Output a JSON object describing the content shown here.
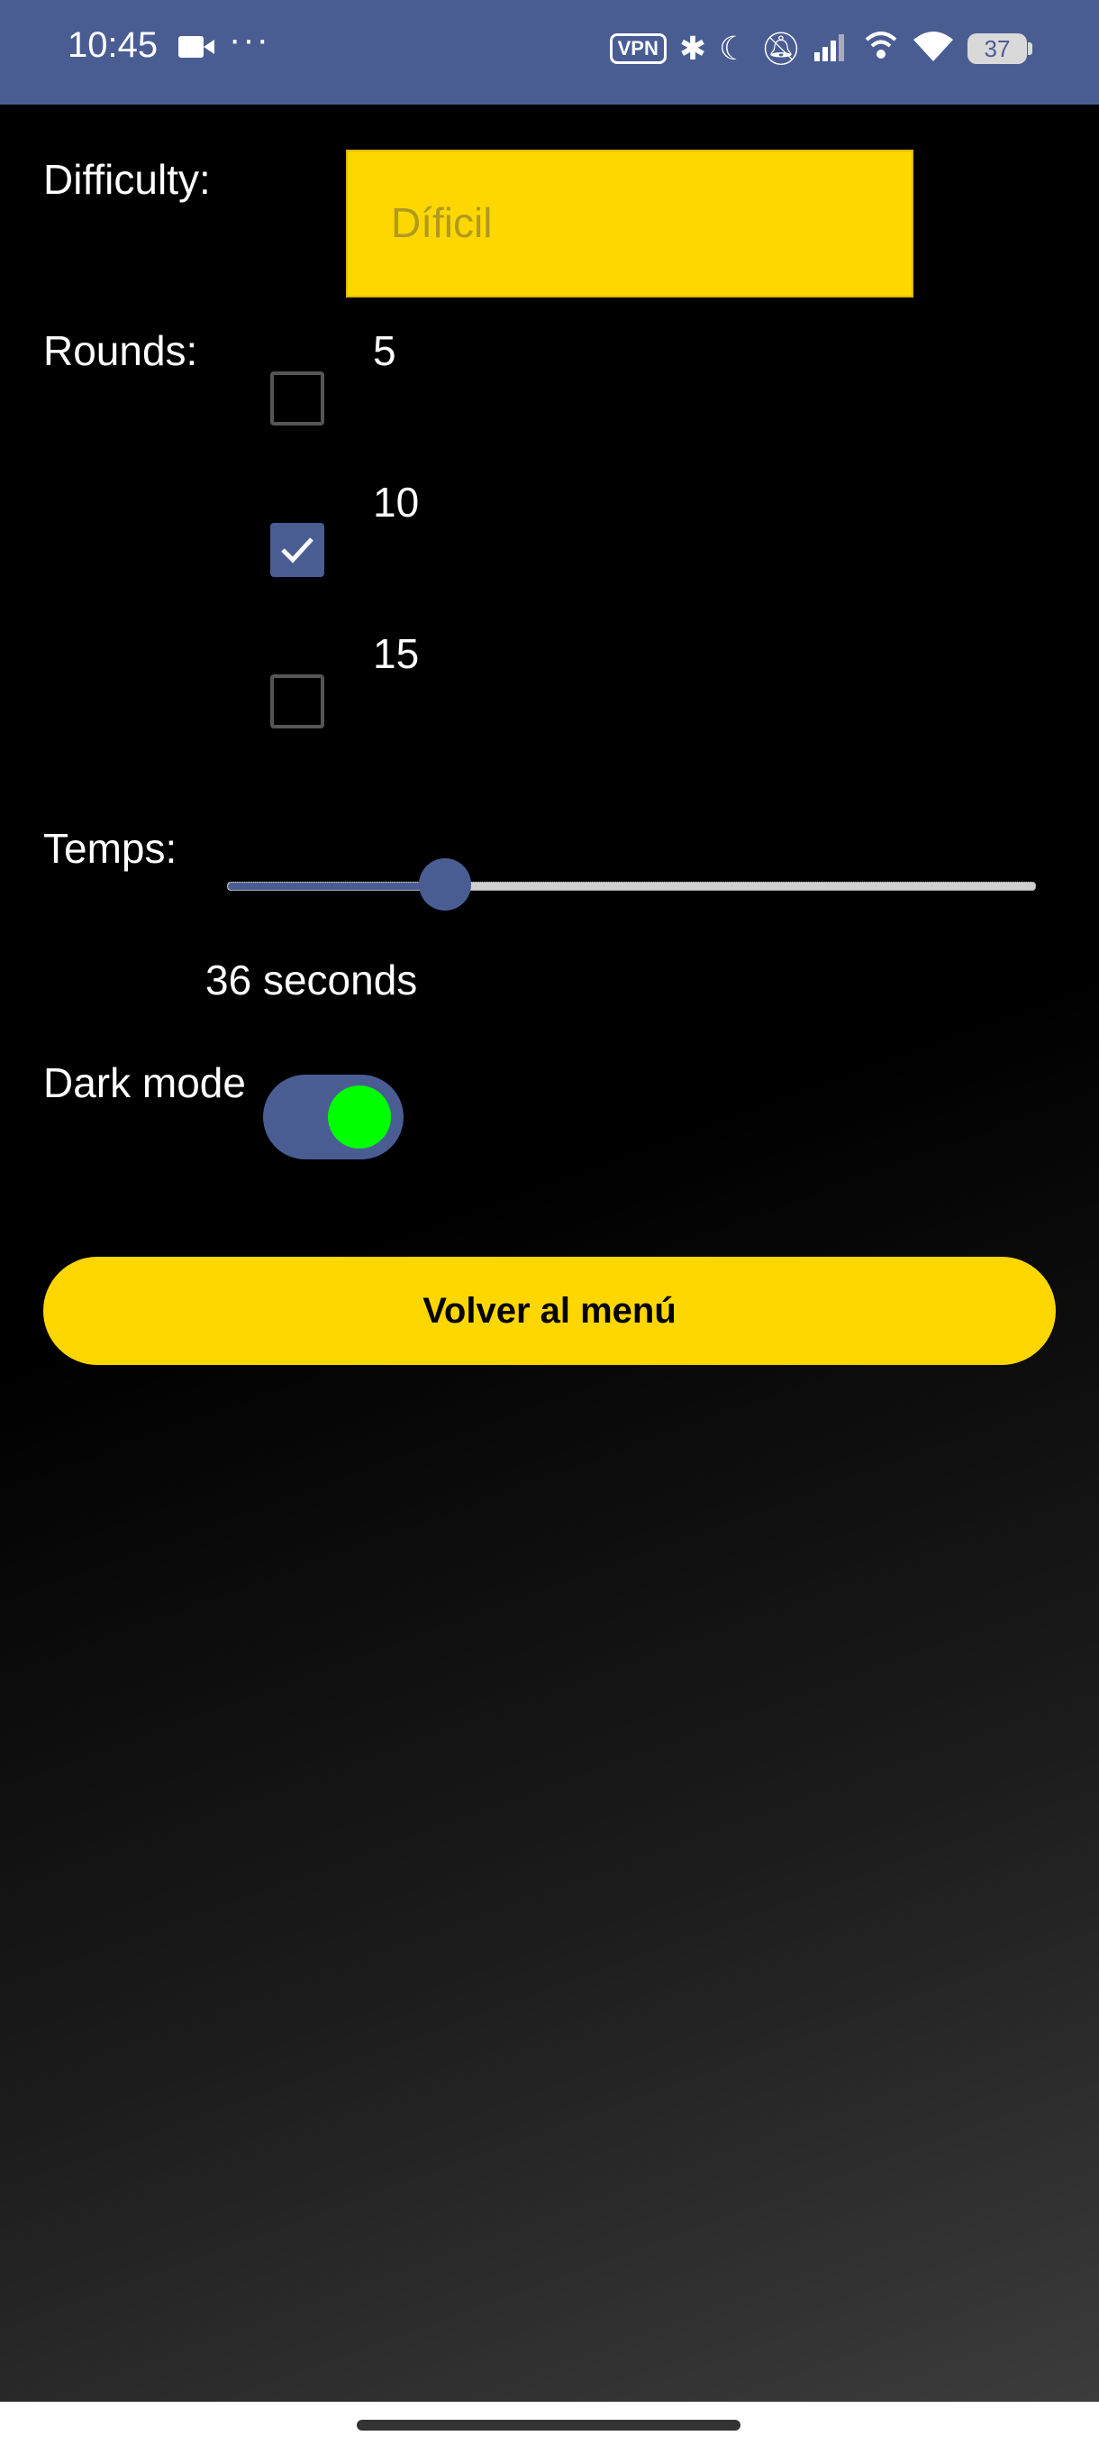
{
  "status_bar": {
    "time": "10:45",
    "more": "···",
    "vpn": "VPN",
    "battery": "37",
    "icons": [
      "video-camera-icon",
      "bluetooth-icon",
      "moon-icon",
      "bell-off-icon",
      "signal-icon",
      "wifi-call-icon",
      "wifi-icon",
      "battery-icon"
    ]
  },
  "settings": {
    "difficulty_label": "Difficulty:",
    "difficulty_value": "Díficil",
    "rounds_label": "Rounds:",
    "rounds_options": [
      {
        "label": "5",
        "checked": false
      },
      {
        "label": "10",
        "checked": true
      },
      {
        "label": "15",
        "checked": false
      }
    ],
    "temps_label": "Temps:",
    "temps_slider_fraction": 0.27,
    "temps_value": "36 seconds",
    "dark_mode_label": "Dark mode",
    "dark_mode_on": true
  },
  "actions": {
    "back_button": "Volver al menú"
  },
  "colors": {
    "accent": "#4a5d93",
    "yellow": "#ffd700",
    "toggle_knob": "#00ff00"
  }
}
